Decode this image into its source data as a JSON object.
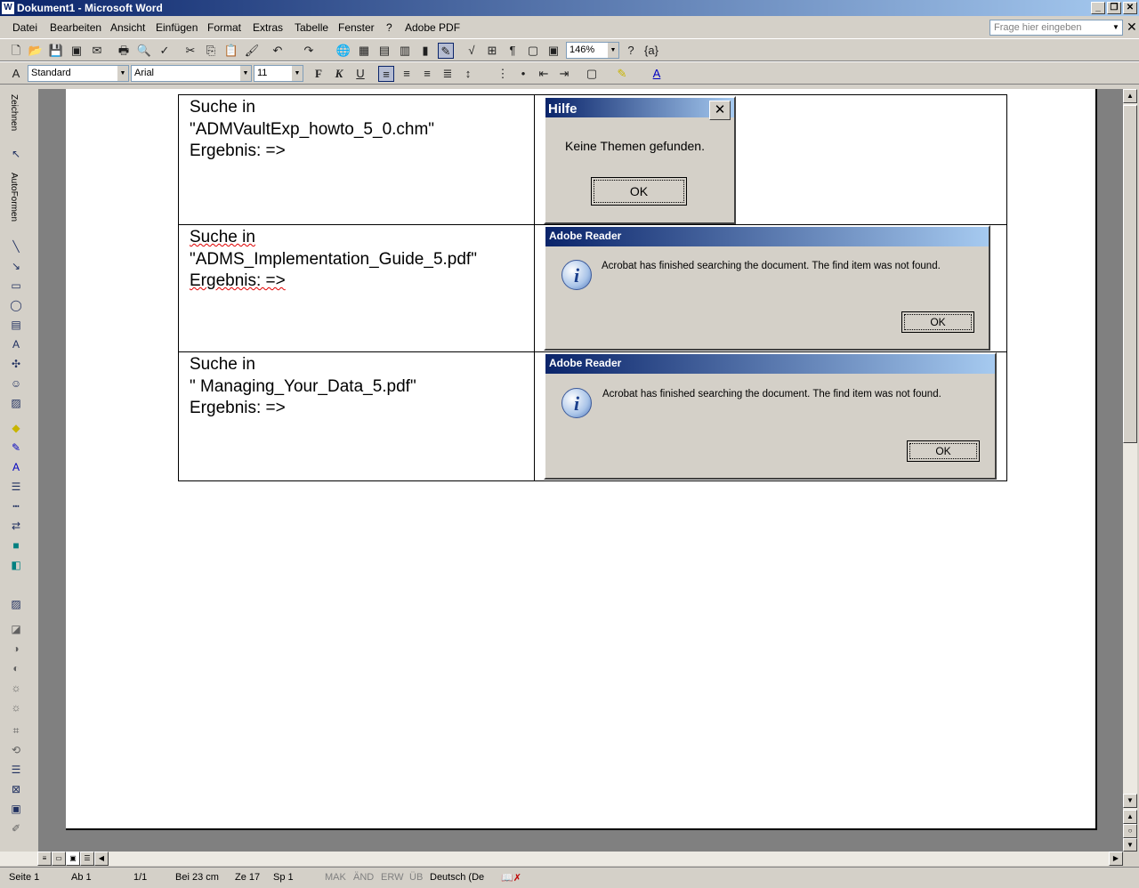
{
  "window": {
    "title": "Dokument1 - Microsoft Word",
    "app_icon": "W"
  },
  "menubar": {
    "items": [
      "Datei",
      "Bearbeiten",
      "Ansicht",
      "Einfügen",
      "Format",
      "Extras",
      "Tabelle",
      "Fenster",
      "?",
      "Adobe PDF"
    ],
    "help_placeholder": "Frage hier eingeben"
  },
  "toolbar": {
    "zoom": "146%"
  },
  "format_toolbar": {
    "style": "Standard",
    "font": "Arial",
    "size": "11",
    "bold": "F",
    "italic": "K",
    "underline": "U"
  },
  "drawing_toolbar": {
    "draw_label": "Zeichnen",
    "autoshapes_label": "AutoFormen"
  },
  "table": {
    "rows": [
      {
        "line1": "Suche in",
        "line2": "\"ADMVaultExp_howto_5_0.chm\"",
        "line3": "Ergebnis: =>"
      },
      {
        "line1": "Suche in",
        "line2": "\"ADMS_Implementation_Guide_5.pdf\"",
        "line3": "Ergebnis: =>"
      },
      {
        "line1": "Suche in",
        "line2": "\" Managing_Your_Data_5.pdf\"",
        "line3": "Ergebnis: =>"
      }
    ]
  },
  "dialogs": {
    "hilfe": {
      "title": "Hilfe",
      "message": "Keine Themen gefunden.",
      "ok": "OK"
    },
    "reader1": {
      "title": "Adobe Reader",
      "message": "Acrobat has finished searching the document. The find item was not found.",
      "ok": "OK"
    },
    "reader2": {
      "title": "Adobe Reader",
      "message": "Acrobat has finished searching the document. The find item was not found.",
      "ok": "OK"
    }
  },
  "statusbar": {
    "page": "Seite 1",
    "section": "Ab 1",
    "pages": "1/1",
    "at": "Bei 23 cm",
    "line": "Ze 17",
    "col": "Sp 1",
    "mak": "MAK",
    "aend": "ÄND",
    "erw": "ERW",
    "ueb": "ÜB",
    "language": "Deutsch (De"
  }
}
